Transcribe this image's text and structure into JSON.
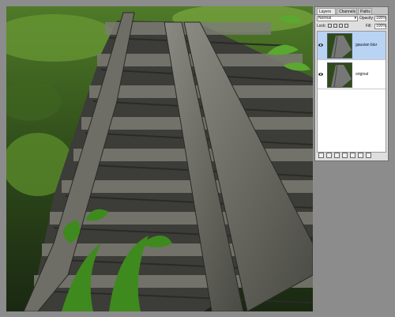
{
  "panel": {
    "tabs": [
      "Layers ×",
      "Channels",
      "Paths"
    ],
    "blend_mode": "Normal",
    "opacity_label": "Opacity:",
    "opacity_value": "100%",
    "lock_label": "Lock:",
    "fill_label": "Fill:",
    "fill_value": "100%",
    "layers": [
      {
        "name": "gausian blur",
        "selected": true
      },
      {
        "name": "original",
        "selected": false
      }
    ]
  },
  "icons": [
    "eye-icon",
    "link-icon",
    "fx-icon",
    "mask-icon",
    "adjustment-icon",
    "folder-icon",
    "new-layer-icon",
    "trash-icon"
  ],
  "colors": {
    "canvas_bg": "#8c8c8c",
    "selected_layer": "#b9d3f5",
    "panel_bg": "#dedede"
  }
}
